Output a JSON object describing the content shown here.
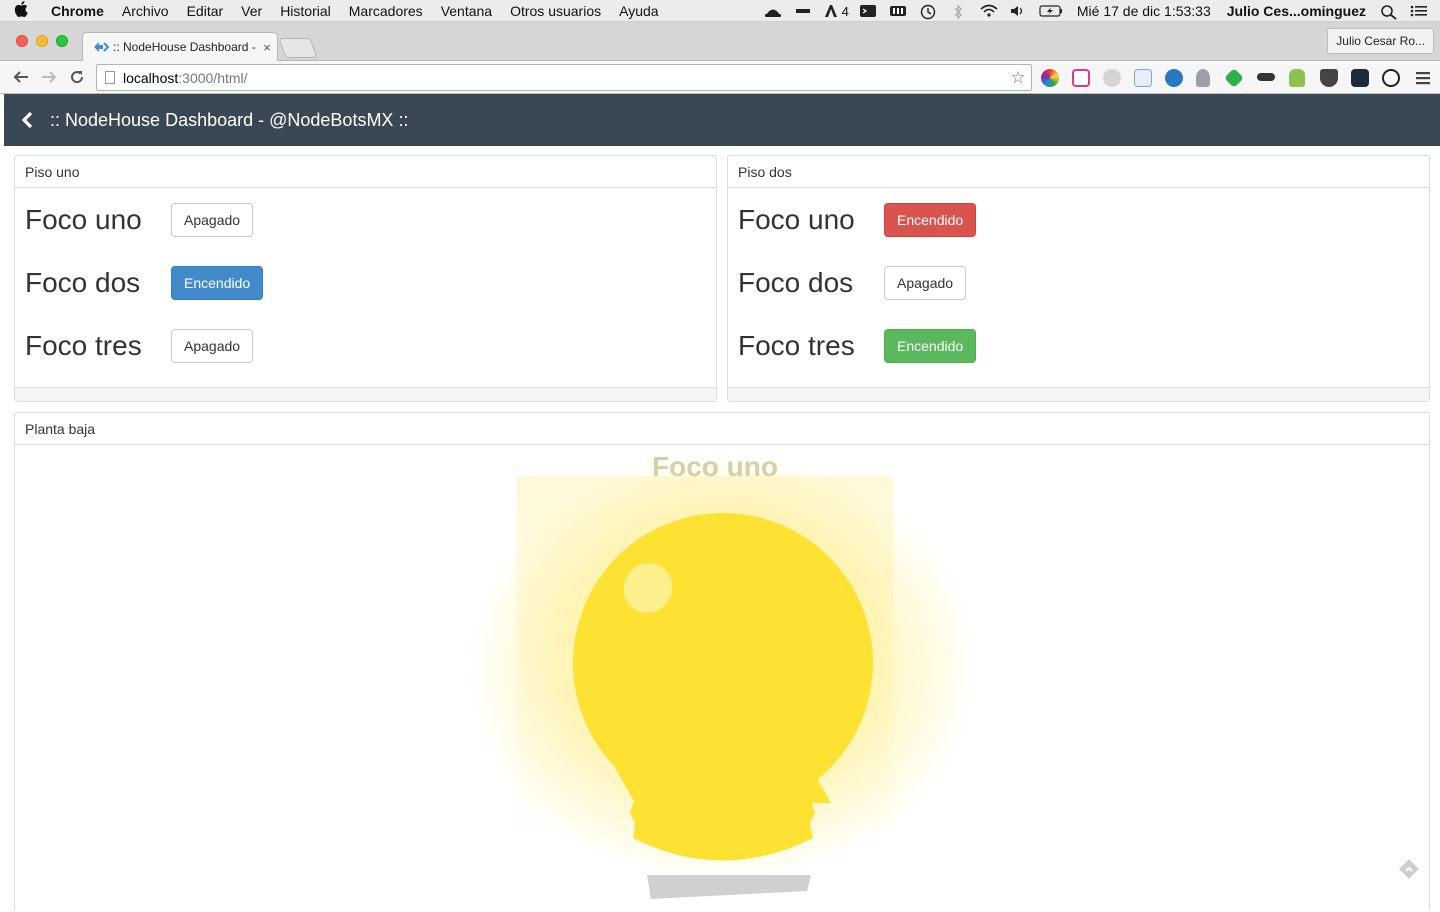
{
  "menubar": {
    "app_name": "Chrome",
    "items": [
      "Archivo",
      "Editar",
      "Ver",
      "Historial",
      "Marcadores",
      "Ventana",
      "Otros usuarios",
      "Ayuda"
    ],
    "status_number": "4",
    "datetime": "Mié 17 de dic  1:53:33",
    "user": "Julio Ces...ominguez"
  },
  "browser": {
    "tab_title": ":: NodeHouse Dashboard - ",
    "tab_close": "×",
    "profile_name": "Julio Cesar Ro...",
    "url_host": "localhost",
    "url_path": ":3000/html/",
    "star": "☆"
  },
  "navbar": {
    "brand": ":: NodeHouse Dashboard - @NodeBotsMX ::"
  },
  "panels": {
    "piso_uno": {
      "title": "Piso uno",
      "rows": [
        {
          "label": "Foco uno",
          "button": "Apagado"
        },
        {
          "label": "Foco dos",
          "button": "Encendido"
        },
        {
          "label": "Foco tres",
          "button": "Apagado"
        }
      ]
    },
    "piso_dos": {
      "title": "Piso dos",
      "rows": [
        {
          "label": "Foco uno",
          "button": "Encendido"
        },
        {
          "label": "Foco dos",
          "button": "Apagado"
        },
        {
          "label": "Foco tres",
          "button": "Encendido"
        }
      ]
    },
    "planta_baja": {
      "title": "Planta baja",
      "bulb_label": "Foco uno"
    }
  },
  "colors": {
    "navbar_bg": "#3a4854",
    "primary": "#428bca",
    "danger": "#d9534f",
    "success": "#5cb85c",
    "bulb_yellow": "#fde234"
  }
}
